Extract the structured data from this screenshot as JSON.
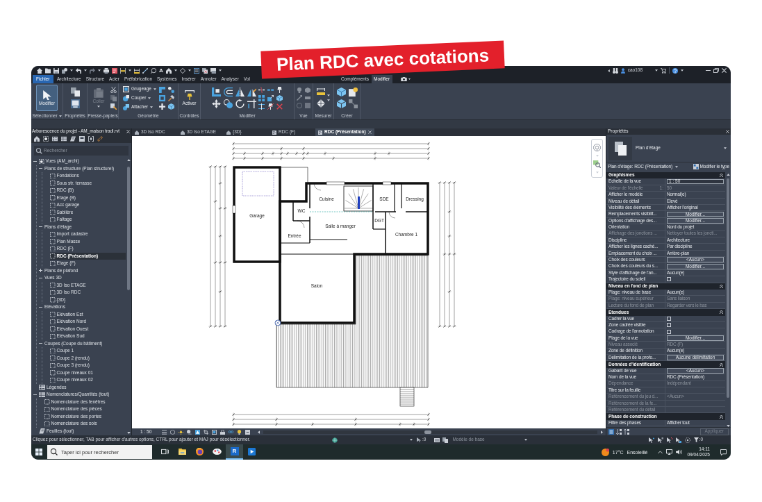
{
  "banner": {
    "text": "Plan RDC avec cotations"
  },
  "title_bar": {
    "text_tool": "A",
    "user": "cao108"
  },
  "ribbon_tabs": [
    {
      "label": "Fichier",
      "kind": "file",
      "selected": false
    },
    {
      "label": "Architecture",
      "kind": "tab",
      "selected": false
    },
    {
      "label": "Structure",
      "kind": "tab",
      "selected": false
    },
    {
      "label": "Acier",
      "kind": "tab",
      "selected": false
    },
    {
      "label": "Préfabrication",
      "kind": "tab",
      "selected": false
    },
    {
      "label": "Systèmes",
      "kind": "tab",
      "selected": false
    },
    {
      "label": "Insérer",
      "kind": "tab",
      "selected": false
    },
    {
      "label": "Annoter",
      "kind": "tab",
      "selected": false
    },
    {
      "label": "Analyser",
      "kind": "tab",
      "selected": false
    },
    {
      "label": "Vol",
      "kind": "tab",
      "selected": false
    },
    {
      "label": "Compléments",
      "kind": "tab",
      "selected": false
    },
    {
      "label": "Modifier",
      "kind": "tab",
      "selected": true
    }
  ],
  "ribbon_panels": [
    {
      "label": "Sélectionner",
      "dropdown": true,
      "buttons": [
        {
          "label": "Modifier",
          "kind": "large",
          "active": true,
          "disabled": false,
          "dropdown": false
        }
      ]
    },
    {
      "label": "Propriétés",
      "dropdown": false
    },
    {
      "label": "Presse-papiers",
      "dropdown": false,
      "buttons": [
        {
          "label": "Coller",
          "kind": "large",
          "active": false,
          "disabled": true,
          "dropdown": true
        }
      ]
    },
    {
      "label": "Géométrie",
      "dropdown": false,
      "buttons": [
        {
          "label": "Grugeage",
          "kind": "small",
          "active": false,
          "disabled": false,
          "dropdown": true
        },
        {
          "label": "Couper",
          "kind": "small",
          "active": false,
          "disabled": false,
          "dropdown": true
        },
        {
          "label": "Attacher",
          "kind": "small",
          "active": false,
          "disabled": false,
          "dropdown": true
        }
      ]
    },
    {
      "label": "Contrôles",
      "dropdown": false,
      "buttons": [
        {
          "label": "Activer",
          "kind": "large",
          "active": false,
          "disabled": false,
          "dropdown": false
        }
      ]
    },
    {
      "label": "Modifier",
      "dropdown": false
    },
    {
      "label": "Vue",
      "dropdown": false
    },
    {
      "label": "Mesurer",
      "dropdown": false
    },
    {
      "label": "Créer",
      "dropdown": false
    }
  ],
  "project_browser": {
    "title": "Arborescence du projet - AM_maison tradi.rvt",
    "search": {
      "placeholder": "Rechercher"
    },
    "tree": [
      {
        "label": "Vues (AM_archi)",
        "kind": "views",
        "expanded": true,
        "selected": false,
        "children": [
          {
            "label": "Plans de structure (Plan structurel)",
            "kind": "category",
            "expanded": true,
            "selected": false,
            "children": [
              {
                "label": "Fondations",
                "kind": "view",
                "selected": false
              },
              {
                "label": "Sous str. terrasse",
                "kind": "view",
                "selected": false
              },
              {
                "label": "RDC (B)",
                "kind": "view",
                "selected": false
              },
              {
                "label": "Etage (B)",
                "kind": "view",
                "selected": false
              },
              {
                "label": "Acc garage",
                "kind": "view",
                "selected": false
              },
              {
                "label": "Sablière",
                "kind": "view",
                "selected": false
              },
              {
                "label": "Faîtage",
                "kind": "view",
                "selected": false
              }
            ]
          },
          {
            "label": "Plans d'étage",
            "kind": "category",
            "expanded": true,
            "selected": false,
            "children": [
              {
                "label": "Import cadastre",
                "kind": "view",
                "selected": false
              },
              {
                "label": "Plan Masse",
                "kind": "view",
                "selected": false
              },
              {
                "label": "RDC (F)",
                "kind": "view",
                "selected": false
              },
              {
                "label": "RDC (Présentation)",
                "kind": "view",
                "selected": true
              },
              {
                "label": "Etage (F)",
                "kind": "view",
                "selected": false
              }
            ]
          },
          {
            "label": "Plans de plafond",
            "kind": "category",
            "expanded": false,
            "selected": false
          },
          {
            "label": "Vues 3D",
            "kind": "category",
            "expanded": true,
            "selected": false,
            "children": [
              {
                "label": "3D Iso ETAGE",
                "kind": "view",
                "selected": false
              },
              {
                "label": "3D Iso RDC",
                "kind": "view",
                "selected": false
              },
              {
                "label": "{3D}",
                "kind": "view",
                "selected": false
              }
            ]
          },
          {
            "label": "Elévations",
            "kind": "category",
            "expanded": true,
            "selected": false,
            "children": [
              {
                "label": "Elévation Est",
                "kind": "view",
                "selected": false
              },
              {
                "label": "Elévation Nord",
                "kind": "view",
                "selected": false
              },
              {
                "label": "Elévation Ouest",
                "kind": "view",
                "selected": false
              },
              {
                "label": "Elévation Sud",
                "kind": "view",
                "selected": false
              }
            ]
          },
          {
            "label": "Coupes (Coupe du bâtiment)",
            "kind": "category",
            "expanded": true,
            "selected": false,
            "children": [
              {
                "label": "Coupe 1",
                "kind": "view",
                "selected": false
              },
              {
                "label": "Coupe 2 (rendu)",
                "kind": "view",
                "selected": false
              },
              {
                "label": "Coupe 3 (rendu)",
                "kind": "view",
                "selected": false
              },
              {
                "label": "Coupe niveaux 01",
                "kind": "view",
                "selected": false
              },
              {
                "label": "Coupe niveaux 02",
                "kind": "view",
                "selected": false
              }
            ]
          }
        ]
      },
      {
        "label": "Légendes",
        "kind": "legends",
        "selected": false
      },
      {
        "label": "Nomenclatures/Quantités (tout)",
        "kind": "schedules",
        "expanded": true,
        "selected": false,
        "children": [
          {
            "label": "Nomenclature des fenêtres",
            "kind": "view",
            "selected": false
          },
          {
            "label": "Nomenclature des pièces",
            "kind": "view",
            "selected": false
          },
          {
            "label": "Nomenclature des portes",
            "kind": "view",
            "selected": false
          },
          {
            "label": "Nomenclature des sols",
            "kind": "view",
            "selected": false
          }
        ]
      },
      {
        "label": "Feuilles (tout)",
        "kind": "sheets",
        "selected": false
      }
    ]
  },
  "view_tabs": [
    {
      "label": "3D Iso RDC",
      "kind": "model",
      "selected": false
    },
    {
      "label": "3D Iso ETAGE",
      "kind": "model",
      "selected": false
    },
    {
      "label": "{3D}",
      "kind": "model",
      "selected": false
    },
    {
      "label": "RDC (F)",
      "kind": "plan",
      "selected": false
    },
    {
      "label": "RDC (Présentation)",
      "kind": "plan",
      "selected": true
    }
  ],
  "plan": {
    "rooms": [
      {
        "name": "Garage"
      },
      {
        "name": "WC"
      },
      {
        "name": "Cuisine"
      },
      {
        "name": "SDE"
      },
      {
        "name": "Dressing"
      },
      {
        "name": "DGT"
      },
      {
        "name": "Salle à manger"
      },
      {
        "name": "Entrée"
      },
      {
        "name": "Chambre 1"
      },
      {
        "name": "Salon"
      }
    ]
  },
  "view_control": {
    "scale": "1 : 50"
  },
  "properties": {
    "title": "Propriétés",
    "type_name": "Plan d'étage",
    "instance": "Plan d'étage: RDC (Présentation)",
    "edit_type": "Modifier le type",
    "sections": [
      {
        "title": "Graphismes",
        "expanded": true,
        "rows": [
          {
            "label": "Echelle de la vue",
            "kind": "field",
            "value": "1 : 50",
            "disabled": false
          },
          {
            "label": "Valeur de l'échelle",
            "unit": "1:",
            "kind": "text",
            "value": "50",
            "disabled": true
          },
          {
            "label": "Afficher le modèle",
            "kind": "text",
            "value": "Normal(e)",
            "disabled": false
          },
          {
            "label": "Niveau de détail",
            "kind": "text",
            "value": "Elevé",
            "disabled": false
          },
          {
            "label": "Visibilité des éléments",
            "kind": "text",
            "value": "Afficher l'original",
            "disabled": false
          },
          {
            "label": "Remplacements visibilit...",
            "kind": "button",
            "value": "Modifier...",
            "disabled": false
          },
          {
            "label": "Options d'affichage des...",
            "kind": "button",
            "value": "Modifier...",
            "disabled": false
          },
          {
            "label": "Orientation",
            "kind": "text",
            "value": "Nord du projet",
            "disabled": false
          },
          {
            "label": "Affichage des jonctions ...",
            "kind": "text",
            "value": "Nettoyer toutes les joncti...",
            "disabled": true
          },
          {
            "label": "Discipline",
            "kind": "text",
            "value": "Architecture",
            "disabled": false
          },
          {
            "label": "Afficher les lignes caché...",
            "kind": "text",
            "value": "Par discipline",
            "disabled": false
          },
          {
            "label": "Emplacement du choix ...",
            "kind": "text",
            "value": "Arrière-plan",
            "disabled": false
          },
          {
            "label": "Choix des couleurs",
            "kind": "button",
            "value": "<Aucun>",
            "disabled": false
          },
          {
            "label": "Choix des couleurs du s...",
            "kind": "button",
            "value": "Modifier...",
            "disabled": false
          },
          {
            "label": "Style d'affichage de l'an...",
            "kind": "text",
            "value": "Aucun(e)",
            "disabled": false
          },
          {
            "label": "Trajectoire du soleil",
            "kind": "checkbox",
            "checked": false,
            "disabled": false
          }
        ]
      },
      {
        "title": "Niveau en fond de plan",
        "expanded": true,
        "rows": [
          {
            "label": "Plage: niveau de base",
            "kind": "text",
            "value": "Aucun(e)",
            "disabled": false
          },
          {
            "label": "Plage: niveau supérieur",
            "kind": "text",
            "value": "Sans liaison",
            "disabled": true
          },
          {
            "label": "Lecture du fond de plan",
            "kind": "text",
            "value": "Regarder vers le bas",
            "disabled": true
          }
        ]
      },
      {
        "title": "Etendues",
        "expanded": true,
        "rows": [
          {
            "label": "Cadrer la vue",
            "kind": "checkbox",
            "checked": false,
            "disabled": false
          },
          {
            "label": "Zone cadrée visible",
            "kind": "checkbox",
            "checked": false,
            "disabled": false
          },
          {
            "label": "Cadrage de l'annotation",
            "kind": "checkbox",
            "checked": false,
            "disabled": false
          },
          {
            "label": "Plage de la vue",
            "kind": "button",
            "value": "Modifier...",
            "disabled": false
          },
          {
            "label": "Niveau associé",
            "kind": "text",
            "value": "RDC (F)",
            "disabled": true
          },
          {
            "label": "Zone de définition",
            "kind": "text",
            "value": "Aucun(e)",
            "disabled": false
          },
          {
            "label": "Délimitation de la profo...",
            "kind": "button",
            "value": "Aucune délimitation",
            "disabled": false
          }
        ]
      },
      {
        "title": "Données d'identification",
        "expanded": true,
        "rows": [
          {
            "label": "Gabarit de vue",
            "kind": "button",
            "value": "<Aucun>",
            "disabled": false
          },
          {
            "label": "Nom de la vue",
            "kind": "text",
            "value": "RDC (Présentation)",
            "disabled": false
          },
          {
            "label": "Dépendance",
            "kind": "text",
            "value": "Indépendant",
            "disabled": true
          },
          {
            "label": "Titre sur la feuille",
            "kind": "text",
            "disabled": false
          },
          {
            "label": "Référencement du jeu d...",
            "kind": "text",
            "value": "<Aucun>",
            "disabled": true
          },
          {
            "label": "Référencement de la fe...",
            "kind": "text",
            "disabled": true
          },
          {
            "label": "Référencement du détail",
            "kind": "text",
            "disabled": true
          }
        ]
      },
      {
        "title": "Phase de construction",
        "expanded": true,
        "rows": [
          {
            "label": "Filtre des phases",
            "kind": "text",
            "value": "Afficher tout",
            "disabled": false
          }
        ]
      }
    ],
    "apply": {
      "label": "Appliquer",
      "disabled": true
    }
  },
  "status_bar": {
    "hint": "Cliquez pour sélectionner, TAB pour afficher d'autres options, CTRL pour ajouter et MAJ pour désélectionner.",
    "selection_count": ":0",
    "model": "Modèle de base",
    "filter_count": ":0"
  },
  "taskbar": {
    "search": {
      "placeholder": "Taper ici pour rechercher"
    },
    "apps": [
      {
        "kind": "task_view",
        "active": false
      },
      {
        "kind": "explorer",
        "active": false
      },
      {
        "kind": "browser",
        "active": false
      },
      {
        "kind": "palette",
        "active": false
      },
      {
        "kind": "revit",
        "glyph": "R",
        "active": true
      },
      {
        "kind": "media",
        "active": false
      }
    ],
    "weather": {
      "temperature": "17°C",
      "condition": "Ensoleillé"
    },
    "time": "14:11",
    "date": "09/04/2025"
  }
}
